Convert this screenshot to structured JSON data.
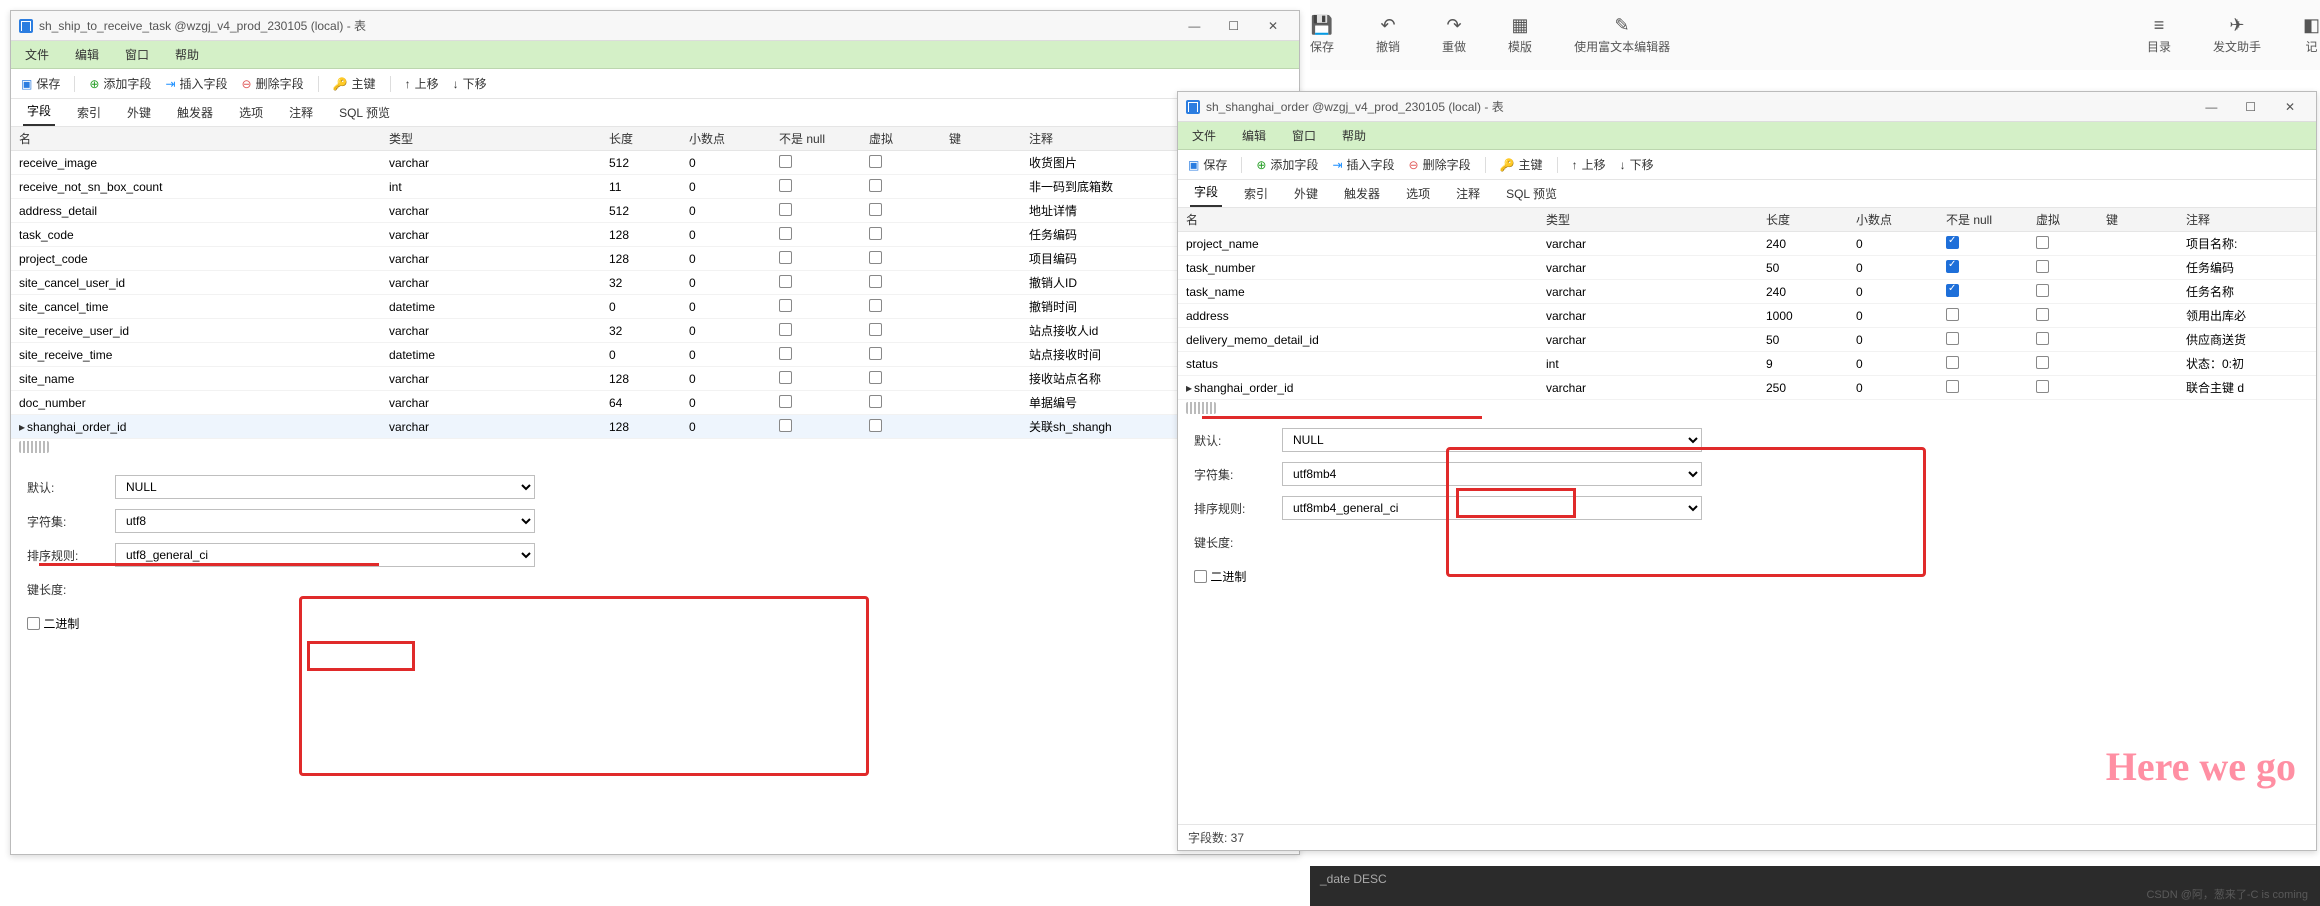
{
  "bg_toolbar": {
    "save": "保存",
    "undo": "撤销",
    "redo": "重做",
    "template": "模版",
    "richtext": "使用富文本编辑器",
    "toc": "目录",
    "helper": "发文助手",
    "note": "记"
  },
  "menus": {
    "file": "文件",
    "edit": "编辑",
    "window": "窗口",
    "help": "帮助"
  },
  "toolbar": {
    "save": "保存",
    "add_field": "添加字段",
    "insert_field": "插入字段",
    "delete_field": "删除字段",
    "primary_key": "主键",
    "move_up": "上移",
    "move_down": "下移"
  },
  "tabs": {
    "field": "字段",
    "index": "索引",
    "fk": "外键",
    "trigger": "触发器",
    "option": "选项",
    "comment": "注释",
    "sql_preview": "SQL 预览"
  },
  "cols": {
    "name": "名",
    "type": "类型",
    "length": "长度",
    "decimal": "小数点",
    "notnull": "不是 null",
    "virtual": "虚拟",
    "key": "键",
    "comment": "注释"
  },
  "props": {
    "default": "默认:",
    "charset": "字符集:",
    "collation": "排序规则:",
    "keylen": "键长度:",
    "binary": "二进制"
  },
  "left": {
    "title": "sh_ship_to_receive_task @wzgj_v4_prod_230105 (local) - 表",
    "rows": [
      {
        "name": "receive_image",
        "type": "varchar",
        "len": "512",
        "dec": "0",
        "cm": "收货图片"
      },
      {
        "name": "receive_not_sn_box_count",
        "type": "int",
        "len": "11",
        "dec": "0",
        "cm": "非一码到底箱数"
      },
      {
        "name": "address_detail",
        "type": "varchar",
        "len": "512",
        "dec": "0",
        "cm": "地址详情"
      },
      {
        "name": "task_code",
        "type": "varchar",
        "len": "128",
        "dec": "0",
        "cm": "任务编码"
      },
      {
        "name": "project_code",
        "type": "varchar",
        "len": "128",
        "dec": "0",
        "cm": "项目编码"
      },
      {
        "name": "site_cancel_user_id",
        "type": "varchar",
        "len": "32",
        "dec": "0",
        "cm": "撤销人ID"
      },
      {
        "name": "site_cancel_time",
        "type": "datetime",
        "len": "0",
        "dec": "0",
        "cm": "撤销时间"
      },
      {
        "name": "site_receive_user_id",
        "type": "varchar",
        "len": "32",
        "dec": "0",
        "cm": "站点接收人id"
      },
      {
        "name": "site_receive_time",
        "type": "datetime",
        "len": "0",
        "dec": "0",
        "cm": "站点接收时间"
      },
      {
        "name": "site_name",
        "type": "varchar",
        "len": "128",
        "dec": "0",
        "cm": "接收站点名称"
      },
      {
        "name": "doc_number",
        "type": "varchar",
        "len": "64",
        "dec": "0",
        "cm": "单据编号"
      },
      {
        "name": "shanghai_order_id",
        "type": "varchar",
        "len": "128",
        "dec": "0",
        "cm": "关联sh_shangh"
      }
    ],
    "field_props": {
      "default": "NULL",
      "charset": "utf8",
      "collation": "utf8_general_ci"
    }
  },
  "right": {
    "title": "sh_shanghai_order @wzgj_v4_prod_230105 (local) - 表",
    "rows": [
      {
        "name": "project_name",
        "type": "varchar",
        "len": "240",
        "dec": "0",
        "nn": true,
        "cm": "项目名称:"
      },
      {
        "name": "task_number",
        "type": "varchar",
        "len": "50",
        "dec": "0",
        "nn": true,
        "cm": "任务编码"
      },
      {
        "name": "task_name",
        "type": "varchar",
        "len": "240",
        "dec": "0",
        "nn": true,
        "cm": "任务名称"
      },
      {
        "name": "address",
        "type": "varchar",
        "len": "1000",
        "dec": "0",
        "nn": false,
        "cm": "领用出库必"
      },
      {
        "name": "delivery_memo_detail_id",
        "type": "varchar",
        "len": "50",
        "dec": "0",
        "nn": false,
        "cm": "供应商送货"
      },
      {
        "name": "status",
        "type": "int",
        "len": "9",
        "dec": "0",
        "nn": false,
        "cm": "状态：0:初"
      },
      {
        "name": "shanghai_order_id",
        "type": "varchar",
        "len": "250",
        "dec": "0",
        "nn": false,
        "cm": "联合主键 d"
      }
    ],
    "field_props": {
      "default": "NULL",
      "charset": "utf8mb4",
      "collation": "utf8mb4_general_ci"
    },
    "footer": "字段数: 37"
  },
  "watermark": "Here we go",
  "csdn": "CSDN @阿，葱来了-C is coming",
  "dark_text": "_date DESC"
}
